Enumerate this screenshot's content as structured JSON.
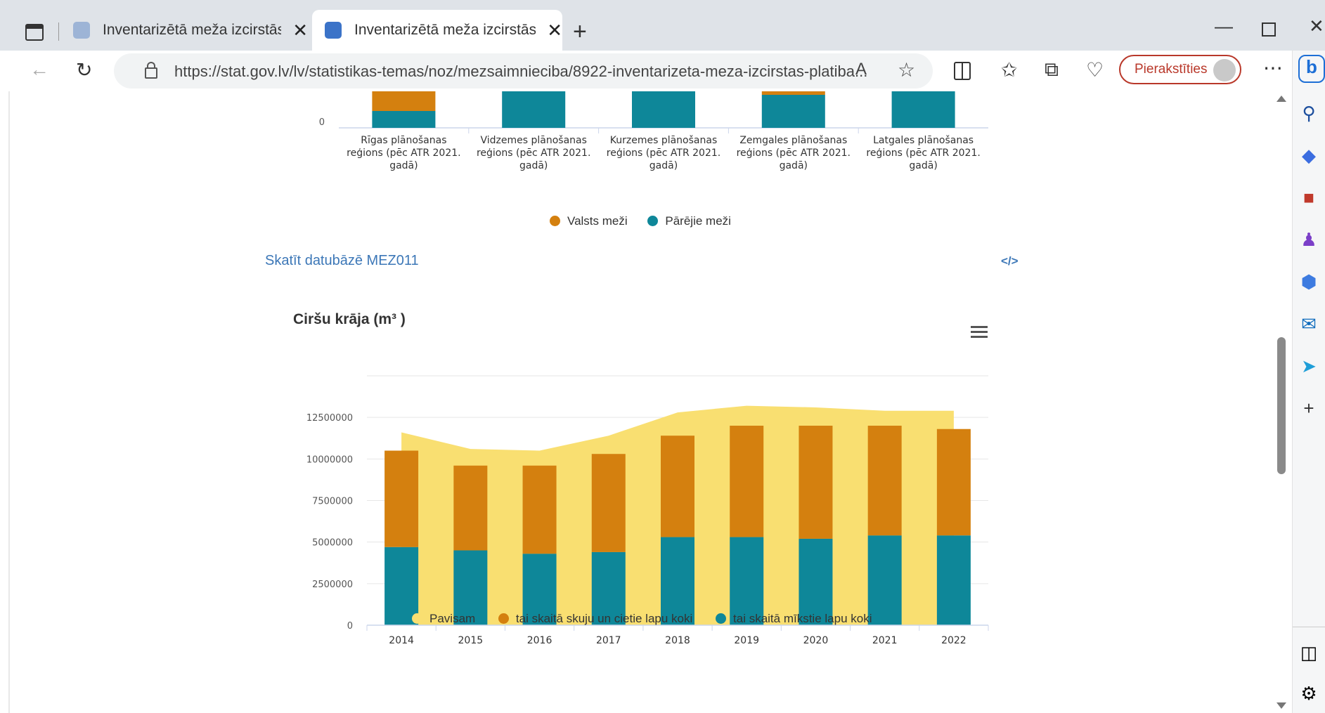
{
  "browser": {
    "tabs": [
      {
        "label": "Inventarizētā meža izcirstās platil",
        "active": false
      },
      {
        "label": "Inventarizētā meža izcirstās platil",
        "active": true
      }
    ],
    "url": "https://stat.gov.lv/lv/statistikas-temas/noz/mezsaimnieciba/8922-inventarizeta-meza-izcirstas-platiba...",
    "url_host": "stat.gov.lv",
    "signin_label": "Pierakstīties",
    "read_aloud_glyph": "A",
    "new_tab_glyph": "+"
  },
  "page": {
    "database_link": "Skatīt datubāzē MEZ011",
    "embed_icon_text": "</>"
  },
  "colors": {
    "orange": "#d4800f",
    "teal": "#0e8799",
    "yellow": "#f9df71",
    "link": "#3c77b7"
  },
  "chart_data": [
    {
      "type": "bar",
      "stacked": true,
      "partially_visible": true,
      "y_tick_visible": "0",
      "categories": [
        "Rīgas plānošanas reģions (pēc ATR 2021. gadā)",
        "Vidzemes plānošanas reģions (pēc ATR 2021. gadā)",
        "Kurzemes plānošanas reģions (pēc ATR 2021. gadā)",
        "Zemgales plānošanas reģions (pēc ATR 2021. gadā)",
        "Latgales plānošanas reģions (pēc ATR 2021. gadā)"
      ],
      "category_lines": [
        [
          "Rīgas plānošanas",
          "reģions (pēc ATR 2021.",
          "gadā)"
        ],
        [
          "Vidzemes plānošanas",
          "reģions (pēc ATR 2021.",
          "gadā)"
        ],
        [
          "Kurzemes plānošanas",
          "reģions (pēc ATR 2021.",
          "gadā)"
        ],
        [
          "Zemgales plānošanas",
          "reģions (pēc ATR 2021.",
          "gadā)"
        ],
        [
          "Latgales plānošanas",
          "reģions (pēc ATR 2021.",
          "gadā)"
        ]
      ],
      "series": [
        {
          "name": "Valsts meži",
          "color": "#d4800f"
        },
        {
          "name": "Pārējie meži",
          "color": "#0e8799"
        }
      ],
      "legend": "bottom"
    },
    {
      "type": "bar",
      "title": "Ciršu krāja (m³ )",
      "categories": [
        "2014",
        "2015",
        "2016",
        "2017",
        "2018",
        "2019",
        "2020",
        "2021",
        "2022"
      ],
      "yticks": [
        "0",
        "2500000",
        "5000000",
        "7500000",
        "10000000",
        "12500000"
      ],
      "ylim": [
        0,
        15000000
      ],
      "grid": true,
      "legend": "bottom",
      "series": [
        {
          "name": "Pavisam",
          "type": "area",
          "color": "#f9df71",
          "values": [
            11600000,
            10600000,
            10500000,
            11400000,
            12800000,
            13200000,
            13100000,
            12900000,
            12900000
          ]
        },
        {
          "name": "tai skaitā skuju un cietie lapu koki",
          "type": "stacked-bar",
          "color": "#d4800f",
          "values": [
            5800000,
            5100000,
            5300000,
            5900000,
            6100000,
            6700000,
            6800000,
            6600000,
            6400000
          ]
        },
        {
          "name": "tai skaitā mīkstie lapu koki",
          "type": "stacked-bar",
          "color": "#0e8799",
          "values": [
            4700000,
            4500000,
            4300000,
            4400000,
            5300000,
            5300000,
            5200000,
            5400000,
            5400000
          ]
        }
      ]
    }
  ]
}
